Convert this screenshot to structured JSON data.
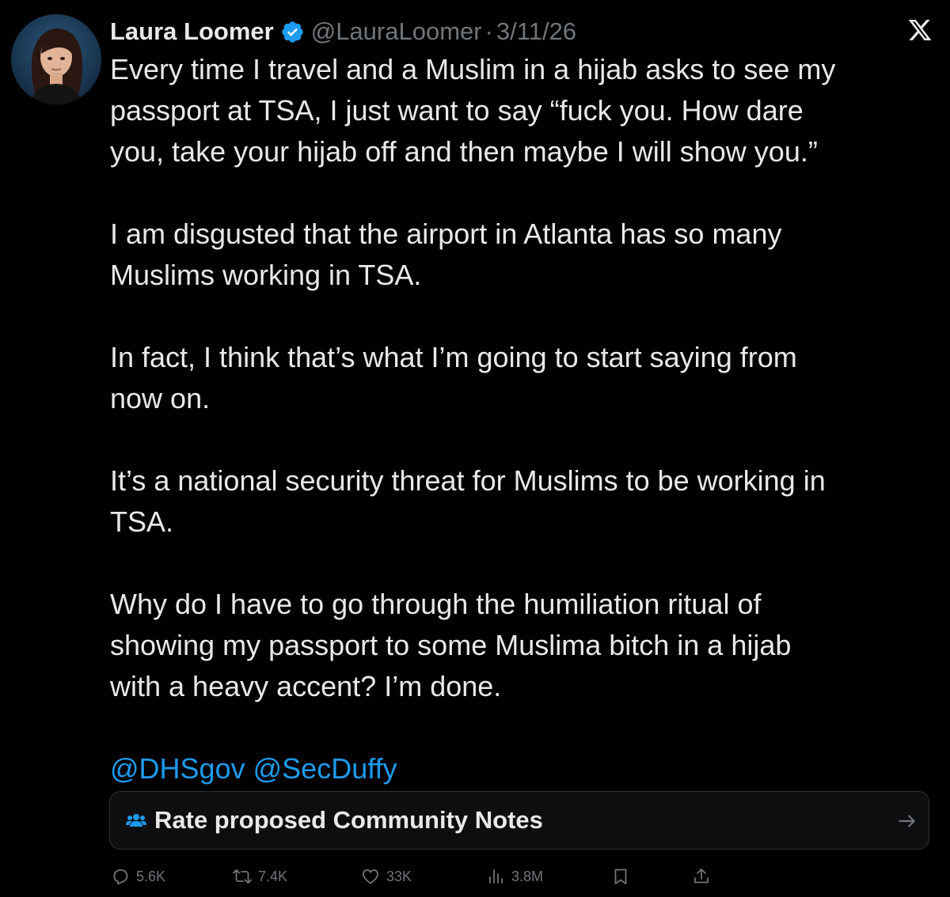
{
  "author": {
    "name": "Laura Loomer",
    "handle": "@LauraLoomer",
    "separator": "·",
    "date": "3/11/26"
  },
  "tweet": {
    "paragraphs": [
      [
        "Every time I travel and a Muslim in a hijab asks to see my",
        "passport at TSA, I just want to say “fuck you. How dare",
        "you, take your hijab off and then maybe I will show you.”"
      ],
      [
        "I am disgusted that the airport in Atlanta has so many",
        "Muslims working in TSA."
      ],
      [
        "In fact, I think that’s what I’m going to start saying from",
        "now on."
      ],
      [
        "It’s a national security threat for Muslims to be working in",
        "TSA."
      ],
      [
        "Why do I have to go through the humiliation ritual of",
        "showing my passport to some Muslima bitch in a hijab",
        "with a heavy accent? I’m done."
      ]
    ],
    "mentions": [
      "@DHSgov",
      "@SecDuffy"
    ]
  },
  "community_notes": {
    "label": "Rate proposed Community Notes",
    "icon": "people-icon",
    "arrow": "arrow-right-icon"
  },
  "actions": {
    "replies": "5.6K",
    "reposts": "7.4K",
    "likes": "33K",
    "views": "3.8M"
  },
  "colors": {
    "background": "#000000",
    "text": "#e7e9ea",
    "muted": "#71767b",
    "accent": "#1d9bf0"
  }
}
